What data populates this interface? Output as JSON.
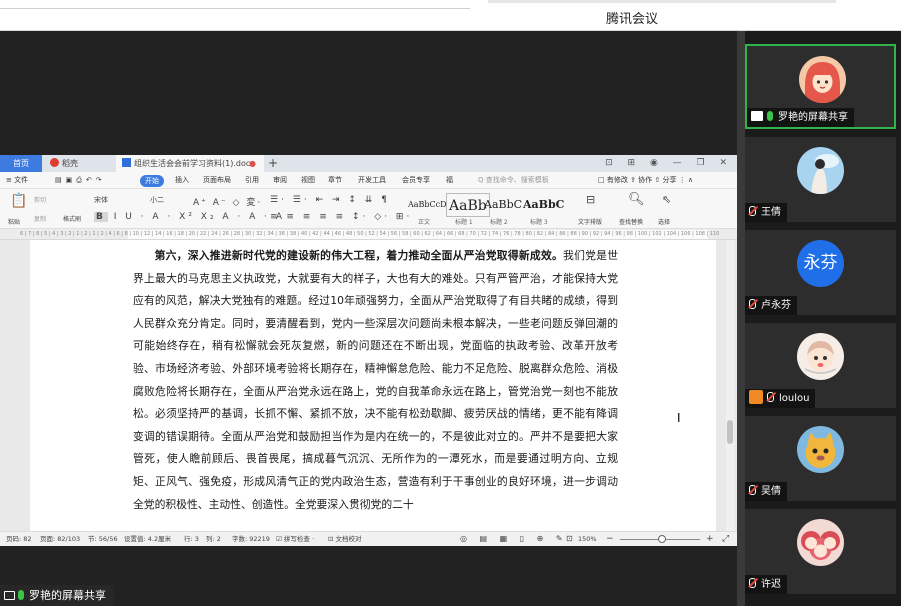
{
  "app": {
    "title": "腾讯会议"
  },
  "wps": {
    "tabs": {
      "home": "首页",
      "draw": "稻壳",
      "doc": "组织生活会会前学习资料(1).docx",
      "plus": "+"
    },
    "window_controls": "⊡ ⊞ ◉ — ❐ ✕",
    "menu": {
      "file": "≡ 文件",
      "start": "开始",
      "items": [
        "插入",
        "页面布局",
        "引用",
        "审阅",
        "视图",
        "章节",
        "开发工具",
        "会员专享",
        "福"
      ],
      "search": "Q 查找命令、搜索模板",
      "right": "□ 有修改  ⇪ 协作  ⇧ 分享  ⋮  ∧"
    },
    "ribbon": {
      "paste": "粘贴",
      "cut": "剪切",
      "copy": "复制",
      "format_painter": "格式刷",
      "font_name": "宋体",
      "font_size": "小二",
      "styles": [
        {
          "preview": "AaBbCcD",
          "label": "正文"
        },
        {
          "preview": "AaBb",
          "label": "标题 1"
        },
        {
          "preview": "AaBbC",
          "label": "标题 2"
        },
        {
          "preview": "AaBbC",
          "label": "标题 3"
        }
      ],
      "text_layout": "文字排版",
      "find_replace": "查找替换",
      "select": "选择"
    },
    "ruler": "6 | 7 | 8 | 5 | 4 | 3 | 2 | 1 | 2 | 1 | 2 | 4 | 6 | 8 | 10 | 12 | 14 | 16 | 18 | 20 | 22 | 24 | 26 | 28 | 30 | 32 | 34 | 36 | 38 | 40 | 42 | 44 | 46 | 48 | 50 | 52 | 54 | 56 | 58 | 60 | 62 | 64 | 66 | 68 | 70 | 72 | 74 | 76 | 78 | 80 | 82 | 84 | 86 | 88 | 90 | 92 | 94 | 96 | 98 | 100 | 102 | 104 | 106 | 108 | 110",
    "document": {
      "bold_lead": "第六，深入推进新时代党的建设新的伟大工程，着力推动全面从严治党取得新成效。",
      "body": "我们党是世界上最大的马克思主义执政党，大就要有大的样子，大也有大的难处。只有严管严治，才能保持大党应有的风范，解决大党独有的难题。经过10年顽强努力，全面从严治党取得了有目共睹的成绩，得到人民群众充分肯定。同时，要清醒看到，党内一些深层次问题尚未根本解决，一些老问题反弹回潮的可能始终存在，稍有松懈就会死灰复燃，新的问题还在不断出现，党面临的执政考验、改革开放考验、市场经济考验、外部环境考验将长期存在，精神懈怠危险、能力不足危险、脱离群众危险、消极腐败危险将长期存在，全面从严治党永远在路上，党的自我革命永远在路上，管党治党一刻也不能放松。必须坚持严的基调，长抓不懈、紧抓不放，决不能有松劲歇脚、疲劳厌战的情绪，更不能有降调变调的错误期待。全面从严治党和鼓励担当作为是内在统一的，不是彼此对立的。严并不是要把大家管死，使人瞻前顾后、畏首畏尾，搞成暮气沉沉、无所作为的一潭死水，而是要通过明方向、立规矩、正风气、强免疫，形成风清气正的党内政治生态，营造有利于干事创业的良好环境，进一步调动全党的积极性、主动性、创造性。全党要深入贯彻党的二十"
    },
    "status": {
      "page_num": "页码: 82",
      "pages": "页面: 82/103",
      "section": "节: 56/56",
      "settings": "设置值: 4.2厘米",
      "row": "行: 3",
      "col": "列: 2",
      "words": "字数: 92219",
      "spell": "☑ 拼写检查 ·",
      "proof": "⊡ 文档校对",
      "zoom": "150%"
    }
  },
  "presenter": {
    "label": "罗艳的屏幕共享"
  },
  "participants": [
    {
      "name": "罗艳的屏幕共享",
      "avatar_color": "#f07a6a",
      "avatar_text": "",
      "active": true,
      "status": "sharing"
    },
    {
      "name": "王倩",
      "avatar_color": "#8fc6e8",
      "avatar_text": "",
      "active": false,
      "status": "muted"
    },
    {
      "name": "卢永芬",
      "avatar_color": "#1f6fe8",
      "avatar_text": "永芬",
      "active": false,
      "status": "muted"
    },
    {
      "name": "loulou",
      "avatar_color": "#f2e4dc",
      "avatar_text": "",
      "active": false,
      "status": "muted-app"
    },
    {
      "name": "吴倩",
      "avatar_color": "#e9a93a",
      "avatar_text": "",
      "active": false,
      "status": "muted"
    },
    {
      "name": "许迟",
      "avatar_color": "#d94b55",
      "avatar_text": "",
      "active": false,
      "status": "muted"
    }
  ]
}
